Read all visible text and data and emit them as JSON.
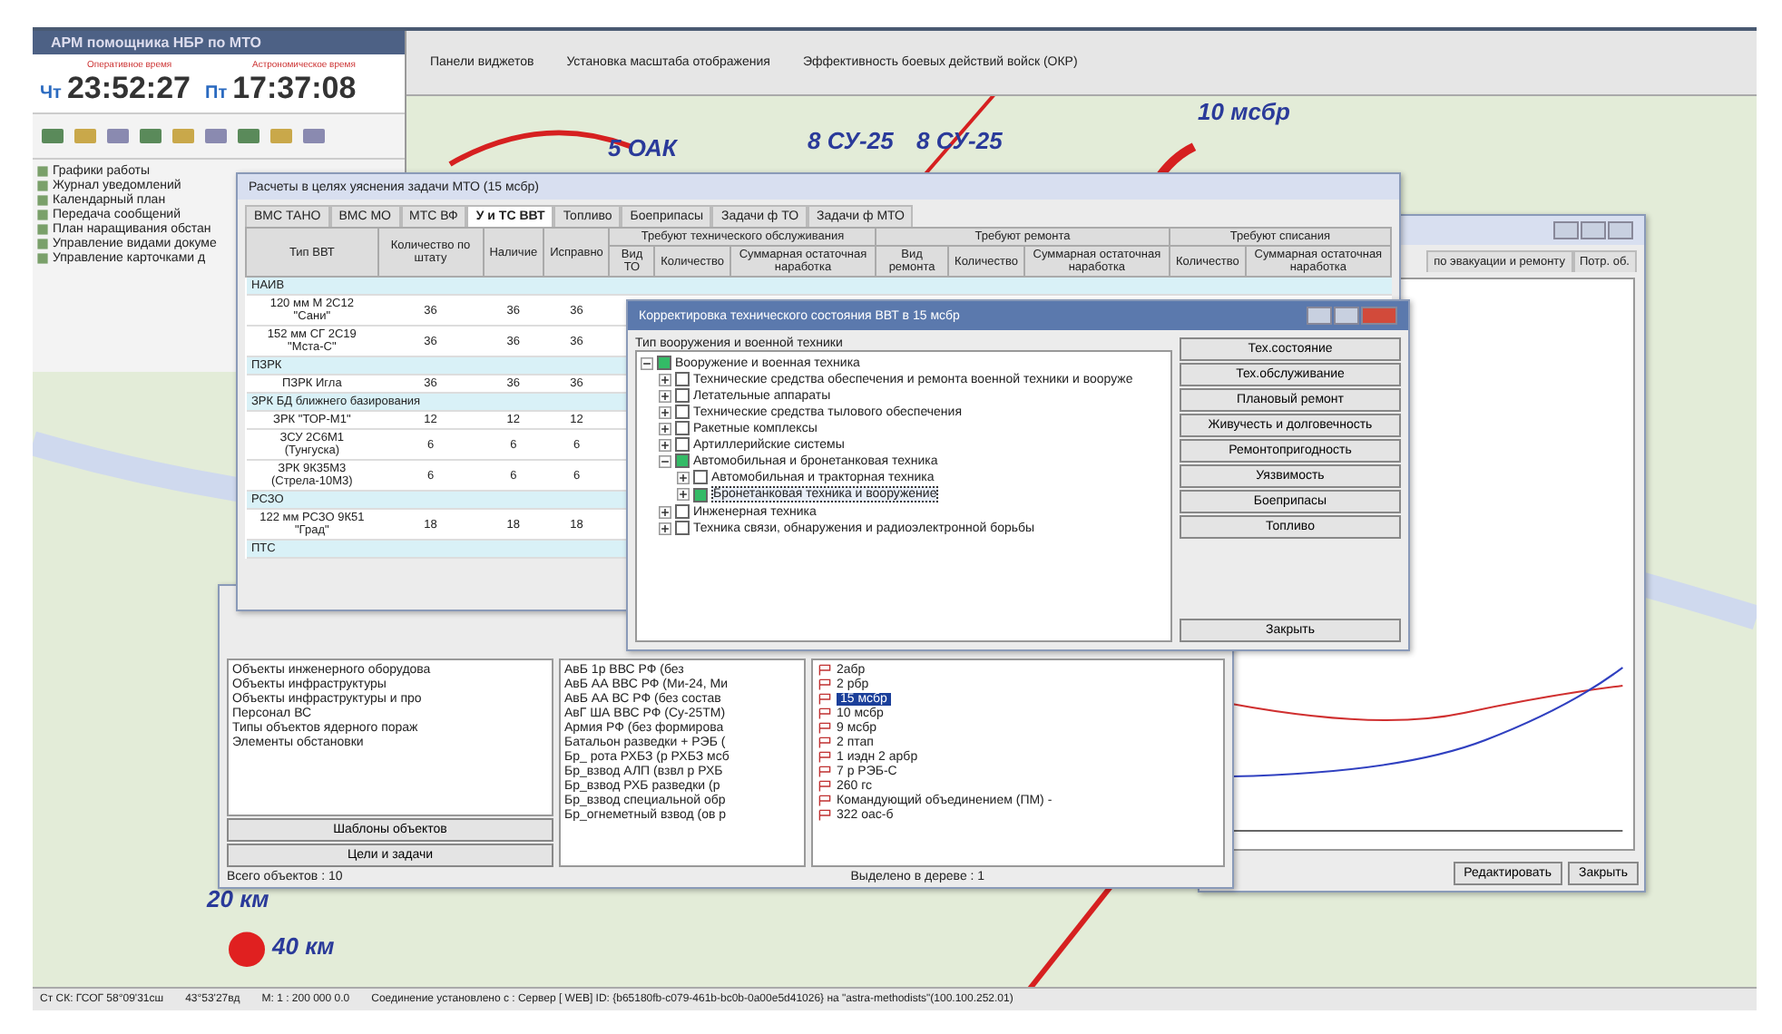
{
  "app_panel": {
    "title": "АРМ помощника НБР по МТО",
    "clocks": [
      {
        "caption": "Оперативное время",
        "day": "Чт",
        "time": "23:52:27"
      },
      {
        "caption": "Астрономическое время",
        "day": "Пт",
        "time": "17:37:08"
      }
    ],
    "menu": [
      "Графики работы",
      "Журнал уведомлений",
      "Календарный план",
      "Передача сообщений",
      "План наращивания обстан",
      "Управление видами докуме",
      "Управление карточками д"
    ]
  },
  "map_toolbar": [
    "Панели виджетов",
    "Установка масштаба отображения",
    "Эффективность боевых действий войск (ОКР)"
  ],
  "map_labels": [
    "5 ОАК",
    "8 СУ-25",
    "8 СУ-25",
    "10 мсбр",
    "20 км",
    "40 км"
  ],
  "calc_window": {
    "title": "Расчеты в целях уяснения задачи МТО (15 мсбр)",
    "tabs": [
      {
        "label": "ВМС ТАНО",
        "selected": false
      },
      {
        "label": "ВМС МО",
        "selected": false
      },
      {
        "label": "МТС ВФ",
        "selected": false
      },
      {
        "label": "У и ТС ВВТ",
        "selected": true
      },
      {
        "label": "Топливо",
        "selected": false
      },
      {
        "label": "Боеприпасы",
        "selected": false
      },
      {
        "label": "Задачи ф ТО",
        "selected": false
      },
      {
        "label": "Задачи ф МТО",
        "selected": false
      }
    ],
    "column_groups": [
      "Требуют технического обслуживания",
      "Требуют ремонта",
      "Требуют списания"
    ],
    "columns": [
      "Тип ВВТ",
      "Количество по штату",
      "Наличие",
      "Исправно",
      "Вид ТО",
      "Количество",
      "Суммарная остаточная наработка",
      "Вид ремонта",
      "Количество",
      "Суммарная остаточная наработка",
      "Количество",
      "Суммарная остаточная наработка"
    ],
    "rows": [
      {
        "kind": "group",
        "label": "НАИВ"
      },
      {
        "kind": "item",
        "cells": [
          "120 мм М 2С12 \"Сани\"",
          "36",
          "36",
          "36"
        ]
      },
      {
        "kind": "item",
        "cells": [
          "152 мм СГ 2С19 \"Мста-С\"",
          "36",
          "36",
          "36"
        ]
      },
      {
        "kind": "group",
        "label": "ПЗРК"
      },
      {
        "kind": "item",
        "cells": [
          "ПЗРК Игла",
          "36",
          "36",
          "36"
        ]
      },
      {
        "kind": "group",
        "label": "ЗРК БД ближнего базирования"
      },
      {
        "kind": "item",
        "cells": [
          "ЗРК \"ТОР-М1\"",
          "12",
          "12",
          "12"
        ]
      },
      {
        "kind": "item",
        "cells": [
          "ЗСУ 2С6М1 (Тунгуска)",
          "6",
          "6",
          "6"
        ]
      },
      {
        "kind": "item",
        "cells": [
          "ЗРК 9К35М3 (Стрела-10М3)",
          "6",
          "6",
          "6"
        ]
      },
      {
        "kind": "group",
        "label": "РСЗО"
      },
      {
        "kind": "item",
        "cells": [
          "122 мм РСЗО 9К51 \"Град\"",
          "18",
          "18",
          "18"
        ]
      },
      {
        "kind": "group",
        "label": "ПТС"
      }
    ]
  },
  "tech_dialog": {
    "title": "Корректировка технического состояния ВВТ в 15 мсбр",
    "group_label": "Тип вооружения и военной техники",
    "tree": [
      {
        "label": "Вооружение и военная техника",
        "checked": true,
        "expanded": true,
        "selected": false,
        "children": [
          {
            "label": "Технические средства обеспечения и ремонта военной техники и вооруже",
            "checked": false,
            "expanded": false,
            "selected": false
          },
          {
            "label": "Летательные аппараты",
            "checked": false,
            "expanded": false,
            "selected": false
          },
          {
            "label": "Технические средства тылового обеспечения",
            "checked": false,
            "expanded": false,
            "selected": false
          },
          {
            "label": "Ракетные комплексы",
            "checked": false,
            "expanded": false,
            "selected": false
          },
          {
            "label": "Артиллерийские системы",
            "checked": false,
            "expanded": false,
            "selected": false
          },
          {
            "label": "Автомобильная и бронетанковая техника",
            "checked": true,
            "expanded": true,
            "selected": false,
            "children": [
              {
                "label": "Автомобильная и тракторная техника",
                "checked": false,
                "expanded": false,
                "selected": false
              },
              {
                "label": "Бронетанковая техника и вооружение",
                "checked": true,
                "expanded": false,
                "selected": true
              }
            ]
          },
          {
            "label": "Инженерная техника",
            "checked": false,
            "expanded": false,
            "selected": false
          },
          {
            "label": "Техника связи, обнаружения и радиоэлектронной борьбы",
            "checked": false,
            "expanded": false,
            "selected": false
          }
        ]
      }
    ],
    "buttons": [
      "Тех.состояние",
      "Тех.обслуживание",
      "Плановый ремонт",
      "Живучесть и долговечность",
      "Ремонтопригодность",
      "Уязвимость",
      "Боеприпасы",
      "Топливо"
    ],
    "close_button": "Закрыть"
  },
  "chart_window": {
    "tabs": [
      "по эвакуации и ремонту",
      "Потр. об."
    ],
    "buttons": [
      "Редактировать",
      "Закрыть"
    ]
  },
  "objects_window": {
    "categories": [
      "Объекты инженерного оборудова",
      "Объекты инфраструктуры",
      "Объекты инфраструктуры и про",
      "Персонал ВС",
      "Типы объектов ядерного пораж",
      "Элементы обстановки"
    ],
    "buttons": [
      "Шаблоны объектов",
      "Цели и задачи"
    ],
    "total": "Всего объектов : 10",
    "units": [
      "АвБ 1р ВВС РФ (без",
      "АвБ АА ВВС РФ (Ми-24, Ми",
      "АвБ АА ВС РФ (без состав",
      "АвГ ША ВВС РФ (Су-25ТМ)",
      "Армия РФ (без формирова",
      "Батальон разведки + РЭБ (",
      "Бр_ рота РХБЗ (р РХБЗ мсб",
      "Бр_взвод АЛП (взвл р РХБ",
      "Бр_взвод РХБ разведки (р",
      "Бр_взвод специальной обр",
      "Бр_огнеметный взвод (ов р"
    ],
    "tree": [
      {
        "label": "2абр",
        "selected": false
      },
      {
        "label": "2 рбр",
        "selected": false
      },
      {
        "label": "15 мсбр",
        "selected": true
      },
      {
        "label": "10 мсбр",
        "selected": false
      },
      {
        "label": "9 мсбр",
        "selected": false
      },
      {
        "label": "2 птап",
        "selected": false
      },
      {
        "label": "1 иэдн 2 арбр",
        "selected": false
      },
      {
        "label": "7 р РЭБ-С",
        "selected": false
      },
      {
        "label": "260 гс",
        "selected": false
      },
      {
        "label": "Командующий объединением (ПМ) -",
        "selected": false
      },
      {
        "label": "322 оас-б",
        "selected": false
      }
    ],
    "selection_status": "Выделено в дереве : 1"
  },
  "status_bar": [
    "Ст СК: ГСОГ 58°09'31сш",
    "43°53'27вд",
    "М: 1 : 200 000  0.0",
    "Соединение установлено с : Сервер [ WEB] ID: {b65180fb-c079-461b-bc0b-0a00e5d41026} на \"astra-methodists\"(100.100.252.01)"
  ]
}
